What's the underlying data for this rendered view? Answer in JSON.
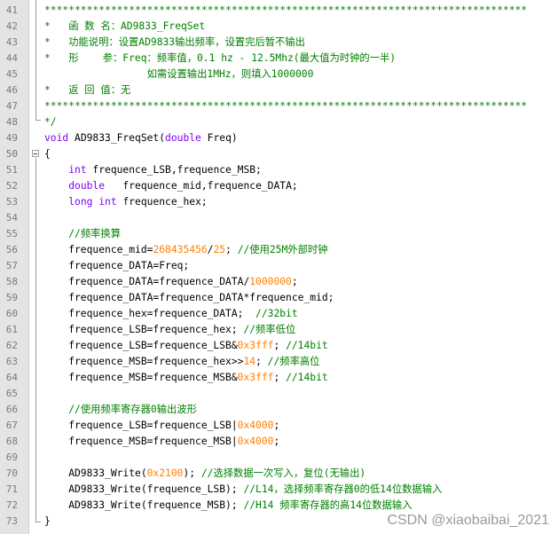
{
  "editor": {
    "lines": [
      {
        "no": "41",
        "tokens": [
          {
            "t": "********************************************************************************",
            "k": "comment"
          }
        ]
      },
      {
        "no": "42",
        "tokens": [
          {
            "t": "*   函 数 名：AD9833_FreqSet",
            "k": "comment"
          }
        ]
      },
      {
        "no": "43",
        "tokens": [
          {
            "t": "*   功能说明：设置AD9833输出频率，设置完后暂不输出",
            "k": "comment"
          }
        ]
      },
      {
        "no": "44",
        "tokens": [
          {
            "t": "*   形    参：Freq：频率值，0.1 hz - 12.5Mhz(最大值为时钟的一半)",
            "k": "comment"
          }
        ]
      },
      {
        "no": "45",
        "tokens": [
          {
            "t": "                 如需设置输出1MHz，则填入1000000",
            "k": "comment"
          }
        ]
      },
      {
        "no": "46",
        "tokens": [
          {
            "t": "*   返 回 值：无",
            "k": "comment"
          }
        ]
      },
      {
        "no": "47",
        "tokens": [
          {
            "t": "********************************************************************************",
            "k": "comment"
          }
        ]
      },
      {
        "no": "48",
        "tokens": [
          {
            "t": "*/",
            "k": "comment"
          }
        ]
      },
      {
        "no": "49",
        "tokens": [
          {
            "t": "void",
            "k": "type"
          },
          {
            "t": " AD9833_FreqSet(",
            "k": "plain"
          },
          {
            "t": "double",
            "k": "type"
          },
          {
            "t": " Freq)",
            "k": "plain"
          }
        ]
      },
      {
        "no": "50",
        "tokens": [
          {
            "t": "{",
            "k": "plain"
          }
        ]
      },
      {
        "no": "51",
        "tokens": [
          {
            "t": "    ",
            "k": "plain"
          },
          {
            "t": "int",
            "k": "type"
          },
          {
            "t": " frequence_LSB,frequence_MSB;",
            "k": "plain"
          }
        ]
      },
      {
        "no": "52",
        "tokens": [
          {
            "t": "    ",
            "k": "plain"
          },
          {
            "t": "double",
            "k": "type"
          },
          {
            "t": "   frequence_mid,frequence_DATA;",
            "k": "plain"
          }
        ]
      },
      {
        "no": "53",
        "tokens": [
          {
            "t": "    ",
            "k": "plain"
          },
          {
            "t": "long int",
            "k": "type"
          },
          {
            "t": " frequence_hex;",
            "k": "plain"
          }
        ]
      },
      {
        "no": "54",
        "tokens": []
      },
      {
        "no": "55",
        "tokens": [
          {
            "t": "    ",
            "k": "plain"
          },
          {
            "t": "//频率换算",
            "k": "comment"
          }
        ]
      },
      {
        "no": "56",
        "tokens": [
          {
            "t": "    frequence_mid=",
            "k": "plain"
          },
          {
            "t": "268435456",
            "k": "num"
          },
          {
            "t": "/",
            "k": "plain"
          },
          {
            "t": "25",
            "k": "num"
          },
          {
            "t": "; ",
            "k": "plain"
          },
          {
            "t": "//使用25M外部时钟",
            "k": "comment"
          }
        ]
      },
      {
        "no": "57",
        "tokens": [
          {
            "t": "    frequence_DATA=Freq;",
            "k": "plain"
          }
        ]
      },
      {
        "no": "58",
        "tokens": [
          {
            "t": "    frequence_DATA=frequence_DATA/",
            "k": "plain"
          },
          {
            "t": "1000000",
            "k": "num"
          },
          {
            "t": ";",
            "k": "plain"
          }
        ]
      },
      {
        "no": "59",
        "tokens": [
          {
            "t": "    frequence_DATA=frequence_DATA*frequence_mid;",
            "k": "plain"
          }
        ]
      },
      {
        "no": "60",
        "tokens": [
          {
            "t": "    frequence_hex=frequence_DATA;  ",
            "k": "plain"
          },
          {
            "t": "//32bit",
            "k": "comment"
          }
        ]
      },
      {
        "no": "61",
        "tokens": [
          {
            "t": "    frequence_LSB=frequence_hex; ",
            "k": "plain"
          },
          {
            "t": "//频率低位",
            "k": "comment"
          }
        ]
      },
      {
        "no": "62",
        "tokens": [
          {
            "t": "    frequence_LSB=frequence_LSB&",
            "k": "plain"
          },
          {
            "t": "0x3fff",
            "k": "num"
          },
          {
            "t": "; ",
            "k": "plain"
          },
          {
            "t": "//14bit",
            "k": "comment"
          }
        ]
      },
      {
        "no": "63",
        "tokens": [
          {
            "t": "    frequence_MSB=frequence_hex>>",
            "k": "plain"
          },
          {
            "t": "14",
            "k": "num"
          },
          {
            "t": "; ",
            "k": "plain"
          },
          {
            "t": "//频率高位",
            "k": "comment"
          }
        ]
      },
      {
        "no": "64",
        "tokens": [
          {
            "t": "    frequence_MSB=frequence_MSB&",
            "k": "plain"
          },
          {
            "t": "0x3fff",
            "k": "num"
          },
          {
            "t": "; ",
            "k": "plain"
          },
          {
            "t": "//14bit",
            "k": "comment"
          }
        ]
      },
      {
        "no": "65",
        "tokens": []
      },
      {
        "no": "66",
        "tokens": [
          {
            "t": "    ",
            "k": "plain"
          },
          {
            "t": "//使用频率寄存器0输出波形",
            "k": "comment"
          }
        ]
      },
      {
        "no": "67",
        "tokens": [
          {
            "t": "    frequence_LSB=frequence_LSB|",
            "k": "plain"
          },
          {
            "t": "0x4000",
            "k": "num"
          },
          {
            "t": ";",
            "k": "plain"
          }
        ]
      },
      {
        "no": "68",
        "tokens": [
          {
            "t": "    frequence_MSB=frequence_MSB|",
            "k": "plain"
          },
          {
            "t": "0x4000",
            "k": "num"
          },
          {
            "t": ";",
            "k": "plain"
          }
        ]
      },
      {
        "no": "69",
        "tokens": []
      },
      {
        "no": "70",
        "tokens": [
          {
            "t": "    AD9833_Write(",
            "k": "plain"
          },
          {
            "t": "0x2100",
            "k": "num"
          },
          {
            "t": "); ",
            "k": "plain"
          },
          {
            "t": "//选择数据一次写入，复位(无输出)",
            "k": "comment"
          }
        ]
      },
      {
        "no": "71",
        "tokens": [
          {
            "t": "    AD9833_Write(frequence_LSB); ",
            "k": "plain"
          },
          {
            "t": "//L14，选择频率寄存器0的低14位数据输入",
            "k": "comment"
          }
        ]
      },
      {
        "no": "72",
        "tokens": [
          {
            "t": "    AD9833_Write(frequence_MSB); ",
            "k": "plain"
          },
          {
            "t": "//H14 频率寄存器的高14位数据输入",
            "k": "comment"
          }
        ]
      },
      {
        "no": "73",
        "tokens": [
          {
            "t": "}",
            "k": "plain"
          }
        ]
      }
    ]
  },
  "watermark": "CSDN @xiaobaibai_2021",
  "colors": {
    "comment": "#008000",
    "type": "#8000ff",
    "number": "#ff8000",
    "plain": "#000000",
    "gutter": "#e4e4e4"
  }
}
